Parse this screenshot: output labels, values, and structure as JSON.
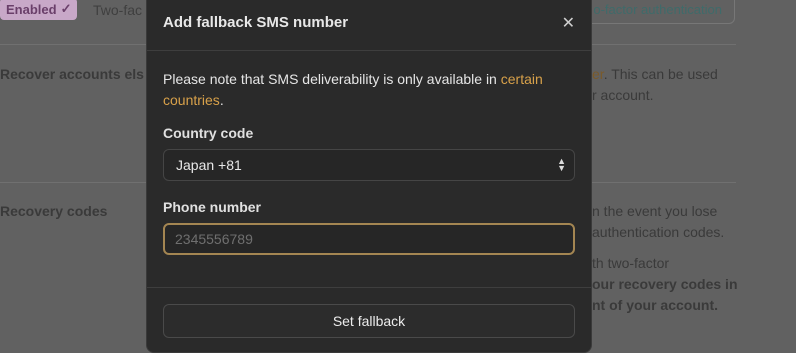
{
  "background": {
    "enabled_badge": "Enabled",
    "badge_suffix_text": "Two-fac",
    "twofactor_button": "o-factor authentication",
    "recover_label": "Recover accounts els",
    "recover_link_frag": "er",
    "recover_desc_1": ". This can be used",
    "recover_desc_2": "r account.",
    "recovery_codes_label": "Recovery codes",
    "recovery_desc_1": "n the event you lose",
    "recovery_desc_2": "authentication codes.",
    "recovery_desc_3": "th two-factor",
    "recovery_desc_4": "our recovery codes in",
    "recovery_desc_5": "nt of your account."
  },
  "modal": {
    "title": "Add fallback SMS number",
    "close_glyph": "✕",
    "note_prefix": "Please note that SMS deliverability is only available in ",
    "note_link": "certain countries",
    "note_suffix": ".",
    "country_label": "Country code",
    "country_value": "Japan +81",
    "phone_label": "Phone number",
    "phone_placeholder": "2345556789",
    "submit_label": "Set fallback"
  }
}
